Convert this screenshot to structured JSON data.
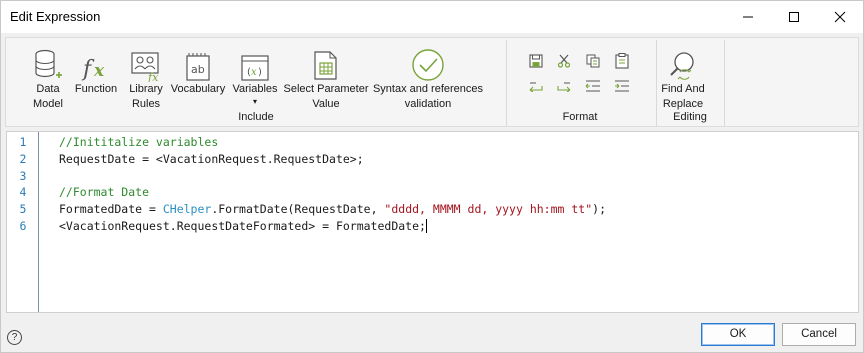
{
  "window": {
    "title": "Edit Expression"
  },
  "ribbon": {
    "include_items": [
      {
        "label_l1": "Data",
        "label_l2": "Model",
        "icon": "database-icon"
      },
      {
        "label_l1": "Function",
        "label_l2": "",
        "icon": "function-icon"
      },
      {
        "label_l1": "Library",
        "label_l2": "Rules",
        "icon": "library-rules-icon"
      },
      {
        "label_l1": "Vocabulary",
        "label_l2": "",
        "icon": "vocabulary-icon"
      },
      {
        "label_l1": "Variables",
        "label_l2": "▾",
        "icon": "variables-icon"
      },
      {
        "label_l1": "Select Parameter",
        "label_l2": "Value",
        "icon": "parameter-icon"
      },
      {
        "label_l1": "Syntax and references",
        "label_l2": "validation",
        "icon": "check-icon"
      }
    ],
    "include_label": "Include",
    "format_label": "Format",
    "editing_item": {
      "label_l1": "Find And",
      "label_l2": "Replace",
      "icon": "find-replace-icon"
    },
    "editing_label": "Editing"
  },
  "editor": {
    "line_numbers": [
      "1",
      "2",
      "3",
      "4",
      "5",
      "6"
    ],
    "lines": [
      {
        "segments": [
          {
            "cls": "cm",
            "text": "//Inititalize variables"
          }
        ]
      },
      {
        "segments": [
          {
            "cls": "",
            "text": "RequestDate = <VacationRequest.RequestDate>;"
          }
        ]
      },
      {
        "segments": []
      },
      {
        "segments": [
          {
            "cls": "cm",
            "text": "//Format Date"
          }
        ]
      },
      {
        "segments": [
          {
            "cls": "",
            "text": "FormatedDate = "
          },
          {
            "cls": "cl",
            "text": "CHelper"
          },
          {
            "cls": "",
            "text": ".FormatDate(RequestDate, "
          },
          {
            "cls": "st",
            "text": "\"dddd, "
          },
          {
            "cls": "st",
            "text": "MMMM"
          },
          {
            "cls": "st",
            "text": " dd, yyyy hh:mm tt\""
          },
          {
            "cls": "",
            "text": ");"
          }
        ]
      },
      {
        "segments": [
          {
            "cls": "",
            "text": "<VacationRequest.RequestDateFormated> = FormatedDate;"
          }
        ]
      }
    ]
  },
  "footer": {
    "help_label": "?",
    "ok_label": "OK",
    "cancel_label": "Cancel"
  },
  "colors": {
    "accent": "#2b7bd6",
    "comment": "#2e8b2e",
    "class": "#2a8fc4",
    "string": "#a3151f",
    "line_number": "#2b7bb9",
    "icon_green": "#7aa33b"
  }
}
